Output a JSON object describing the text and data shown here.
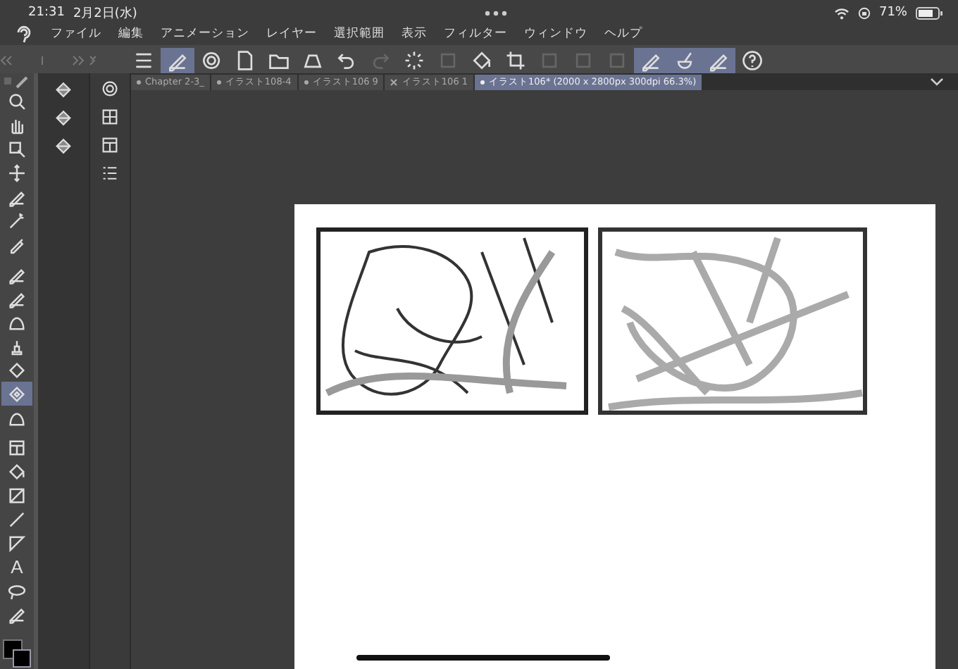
{
  "status_bar": {
    "time": "21:31",
    "date": "2月2日(水)",
    "battery": "71%"
  },
  "menu": [
    "ファイル",
    "編集",
    "アニメーション",
    "レイヤー",
    "選択範囲",
    "表示",
    "フィルター",
    "ウィンドウ",
    "ヘルプ"
  ],
  "toolbar": [
    {
      "kind": "menu",
      "selected": false,
      "disabled": false
    },
    {
      "kind": "pen",
      "selected": true,
      "disabled": false
    },
    {
      "kind": "circle",
      "selected": false,
      "disabled": false
    },
    {
      "kind": "file",
      "selected": false,
      "disabled": false
    },
    {
      "kind": "folder",
      "selected": false,
      "disabled": false
    },
    {
      "kind": "tray",
      "selected": false,
      "disabled": false
    },
    {
      "kind": "undo",
      "selected": false,
      "disabled": false
    },
    {
      "kind": "redo",
      "selected": false,
      "disabled": true
    },
    {
      "kind": "spin",
      "selected": false,
      "disabled": false
    },
    {
      "kind": "square",
      "selected": false,
      "disabled": true
    },
    {
      "kind": "bucket",
      "selected": false,
      "disabled": false
    },
    {
      "kind": "crop",
      "selected": false,
      "disabled": false
    },
    {
      "kind": "square",
      "selected": false,
      "disabled": true
    },
    {
      "kind": "square",
      "selected": false,
      "disabled": true
    },
    {
      "kind": "square",
      "selected": false,
      "disabled": true
    },
    {
      "kind": "pen",
      "selected": true,
      "disabled": false
    },
    {
      "kind": "brush",
      "selected": true,
      "disabled": false
    },
    {
      "kind": "pen",
      "selected": true,
      "disabled": false
    },
    {
      "kind": "help",
      "selected": false,
      "disabled": false
    }
  ],
  "tabs": [
    {
      "label": "Chapter 2-3_",
      "selected": false,
      "closable": false
    },
    {
      "label": "イラスト108-4",
      "selected": false,
      "closable": false
    },
    {
      "label": "イラスト106 9",
      "selected": false,
      "closable": false
    },
    {
      "label": "イラスト106 1",
      "selected": false,
      "closable": true
    },
    {
      "label": "イラスト106* (2000 x 2800px 300dpi 66.3%)",
      "selected": true,
      "closable": false
    }
  ],
  "tools": [
    {
      "kind": "zoom",
      "selected": false
    },
    {
      "kind": "hand",
      "selected": false
    },
    {
      "kind": "select",
      "selected": false
    },
    {
      "kind": "move",
      "selected": false
    },
    {
      "kind": "pen",
      "selected": false
    },
    {
      "kind": "wand",
      "selected": false
    },
    {
      "kind": "dropper",
      "selected": false
    },
    {
      "kind": "pen",
      "selected": false
    },
    {
      "kind": "pen",
      "selected": false
    },
    {
      "kind": "blob",
      "selected": false
    },
    {
      "kind": "stamp",
      "selected": false
    },
    {
      "kind": "dots",
      "selected": false
    },
    {
      "kind": "diamond",
      "selected": true
    },
    {
      "kind": "blob",
      "selected": false
    },
    {
      "kind": "frame",
      "selected": false
    },
    {
      "kind": "bucket",
      "selected": false
    },
    {
      "kind": "gradient",
      "selected": false
    },
    {
      "kind": "line",
      "selected": false
    },
    {
      "kind": "ruler",
      "selected": false
    },
    {
      "kind": "text",
      "glyph": "A",
      "selected": false
    },
    {
      "kind": "lasso",
      "selected": false
    },
    {
      "kind": "pen",
      "selected": false
    }
  ],
  "subtools": [
    {
      "kind": "eraser"
    },
    {
      "kind": "eraser"
    },
    {
      "kind": "eraser"
    }
  ],
  "panels": [
    {
      "kind": "circle"
    },
    {
      "kind": "grid"
    },
    {
      "kind": "frame"
    },
    {
      "kind": "list"
    }
  ]
}
